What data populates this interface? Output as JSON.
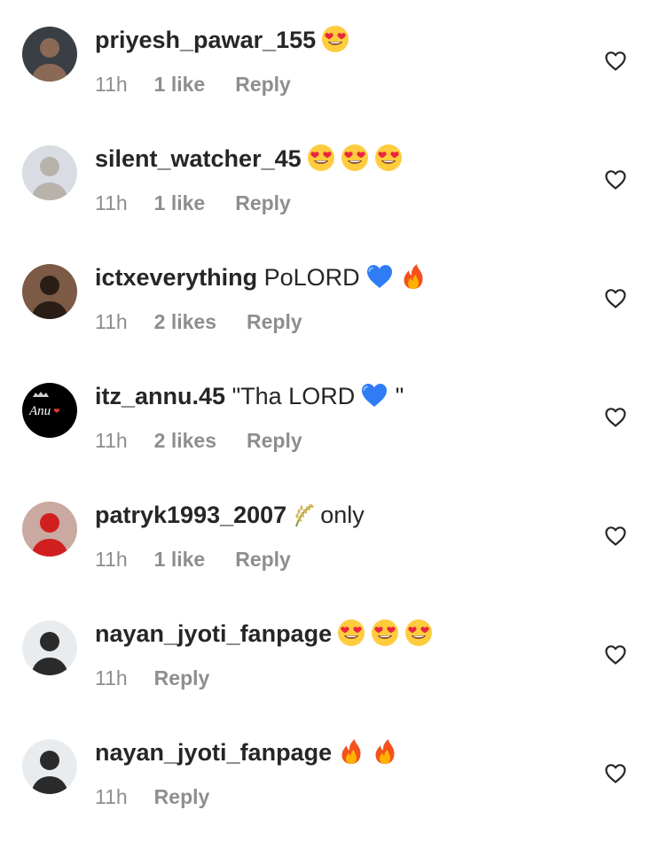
{
  "comments": [
    {
      "username": "priyesh_pawar_155",
      "text": "",
      "emojis": [
        "heart-eyes-emoji"
      ],
      "time": "11h",
      "likes": "1 like",
      "reply": "Reply",
      "avatar": {
        "bg": "#3a3f46",
        "accent": "#8a6a56"
      }
    },
    {
      "username": "silent_watcher_45",
      "text": "",
      "emojis": [
        "heart-eyes-emoji",
        "heart-eyes-emoji",
        "heart-eyes-emoji"
      ],
      "time": "11h",
      "likes": "1 like",
      "reply": "Reply",
      "avatar": {
        "bg": "#d9dde3",
        "accent": "#b9b2ab"
      }
    },
    {
      "username": "ictxeverything",
      "text": "PoLORD",
      "emojis": [
        "blue-heart-emoji",
        "fire-emoji"
      ],
      "time": "11h",
      "likes": "2 likes",
      "reply": "Reply",
      "avatar": {
        "bg": "#7c5a45",
        "accent": "#2a1d16"
      }
    },
    {
      "username": "itz_annu.45",
      "text": "\"Tha LORD",
      "text_after": " \"",
      "emojis": [
        "blue-heart-emoji"
      ],
      "time": "11h",
      "likes": "2 likes",
      "reply": "Reply",
      "avatar": {
        "bg": "#000000",
        "accent": "#ffffff",
        "logo_text": "Anu"
      }
    },
    {
      "username": "patryk1993_2007",
      "text_after": "only",
      "emojis": [
        "rice-emoji"
      ],
      "time": "11h",
      "likes": "1 like",
      "reply": "Reply",
      "avatar": {
        "bg": "#c9a9a0",
        "accent": "#d11f1f"
      }
    },
    {
      "username": "nayan_jyoti_fanpage",
      "text": "",
      "emojis": [
        "heart-eyes-emoji",
        "heart-eyes-emoji",
        "heart-eyes-emoji"
      ],
      "time": "11h",
      "likes": "",
      "reply": "Reply",
      "avatar": {
        "bg": "#e9ecef",
        "accent": "#2b2b2b"
      }
    },
    {
      "username": "nayan_jyoti_fanpage",
      "text": "",
      "emojis": [
        "fire-emoji",
        "fire-emoji"
      ],
      "time": "11h",
      "likes": "",
      "reply": "Reply",
      "avatar": {
        "bg": "#e9ecef",
        "accent": "#2b2b2b"
      }
    }
  ],
  "colors": {
    "username": "#262626",
    "meta": "#8e8e8e",
    "heart_outline": "#262626"
  },
  "icons": {
    "like": "heart-outline-icon"
  }
}
